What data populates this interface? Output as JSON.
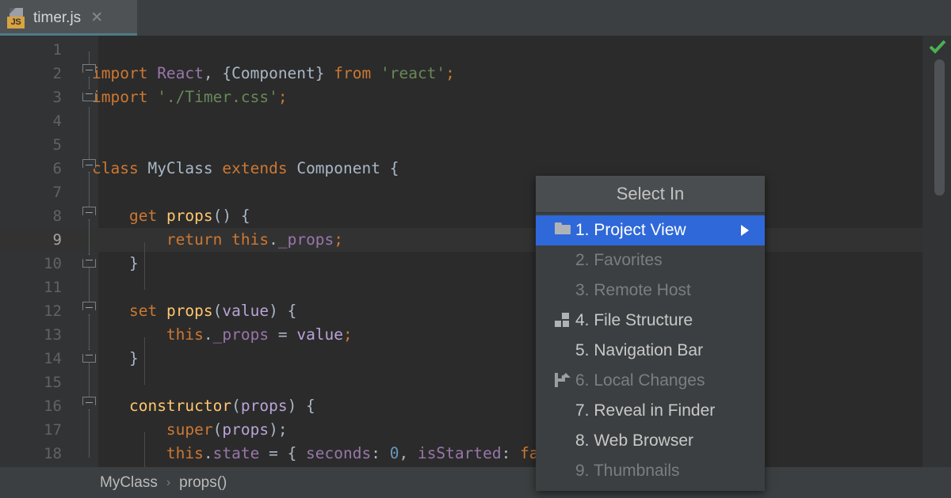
{
  "window": {
    "background": "#3c3f41",
    "editor_background": "#2b2b2b"
  },
  "tab": {
    "title": "timer.js",
    "file_type_badge": "JS",
    "close_label": "✕",
    "icon": "js-file-icon",
    "accent_color": "#4d7b87"
  },
  "editor": {
    "current_line": 9,
    "inspection_status": "ok",
    "lines": [
      {
        "n": 1,
        "tokens": []
      },
      {
        "n": 2,
        "tokens": [
          {
            "t": "import ",
            "c": "kw"
          },
          {
            "t": "React",
            "c": "fld"
          },
          {
            "t": ", ",
            "c": "pun"
          },
          {
            "t": "{Component}",
            "c": "cls"
          },
          {
            "t": " ",
            "c": "pun"
          },
          {
            "t": "from",
            "c": "kw"
          },
          {
            "t": " ",
            "c": "pun"
          },
          {
            "t": "'react'",
            "c": "str"
          },
          {
            "t": ";",
            "c": "kw"
          }
        ]
      },
      {
        "n": 3,
        "tokens": [
          {
            "t": "import ",
            "c": "kw"
          },
          {
            "t": "'./Timer.css'",
            "c": "str"
          },
          {
            "t": ";",
            "c": "kw"
          }
        ]
      },
      {
        "n": 4,
        "tokens": []
      },
      {
        "n": 5,
        "tokens": []
      },
      {
        "n": 6,
        "tokens": [
          {
            "t": "class",
            "c": "kw"
          },
          {
            "t": " ",
            "c": "pun"
          },
          {
            "t": "MyClass",
            "c": "cls"
          },
          {
            "t": " ",
            "c": "pun"
          },
          {
            "t": "extends",
            "c": "kw"
          },
          {
            "t": " ",
            "c": "pun"
          },
          {
            "t": "Component",
            "c": "cls"
          },
          {
            "t": " {",
            "c": "pun"
          }
        ]
      },
      {
        "n": 7,
        "tokens": []
      },
      {
        "n": 8,
        "tokens": [
          {
            "t": "    ",
            "c": "pun"
          },
          {
            "t": "get",
            "c": "kw"
          },
          {
            "t": " ",
            "c": "pun"
          },
          {
            "t": "props",
            "c": "fn"
          },
          {
            "t": "() {",
            "c": "pun"
          }
        ]
      },
      {
        "n": 9,
        "tokens": [
          {
            "t": "        ",
            "c": "pun"
          },
          {
            "t": "return",
            "c": "kw"
          },
          {
            "t": " ",
            "c": "pun"
          },
          {
            "t": "this",
            "c": "kw"
          },
          {
            "t": ".",
            "c": "pun"
          },
          {
            "t": "_props",
            "c": "fld"
          },
          {
            "t": ";",
            "c": "kw"
          }
        ]
      },
      {
        "n": 10,
        "tokens": [
          {
            "t": "    }",
            "c": "pun"
          }
        ]
      },
      {
        "n": 11,
        "tokens": []
      },
      {
        "n": 12,
        "tokens": [
          {
            "t": "    ",
            "c": "pun"
          },
          {
            "t": "set",
            "c": "kw"
          },
          {
            "t": " ",
            "c": "pun"
          },
          {
            "t": "props",
            "c": "fn"
          },
          {
            "t": "(",
            "c": "pun"
          },
          {
            "t": "value",
            "c": "par"
          },
          {
            "t": ") {",
            "c": "pun"
          }
        ]
      },
      {
        "n": 13,
        "tokens": [
          {
            "t": "        ",
            "c": "pun"
          },
          {
            "t": "this",
            "c": "kw"
          },
          {
            "t": ".",
            "c": "pun"
          },
          {
            "t": "_props",
            "c": "fld"
          },
          {
            "t": " = ",
            "c": "pun"
          },
          {
            "t": "value",
            "c": "par"
          },
          {
            "t": ";",
            "c": "kw"
          }
        ]
      },
      {
        "n": 14,
        "tokens": [
          {
            "t": "    }",
            "c": "pun"
          }
        ]
      },
      {
        "n": 15,
        "tokens": []
      },
      {
        "n": 16,
        "tokens": [
          {
            "t": "    ",
            "c": "pun"
          },
          {
            "t": "constructor",
            "c": "fn"
          },
          {
            "t": "(",
            "c": "pun"
          },
          {
            "t": "props",
            "c": "par"
          },
          {
            "t": ") {",
            "c": "pun"
          }
        ]
      },
      {
        "n": 17,
        "tokens": [
          {
            "t": "        ",
            "c": "pun"
          },
          {
            "t": "super",
            "c": "kw"
          },
          {
            "t": "(",
            "c": "pun"
          },
          {
            "t": "props",
            "c": "par"
          },
          {
            "t": ");",
            "c": "pun"
          }
        ]
      },
      {
        "n": 18,
        "tokens": [
          {
            "t": "        ",
            "c": "pun"
          },
          {
            "t": "this",
            "c": "kw"
          },
          {
            "t": ".",
            "c": "pun"
          },
          {
            "t": "state",
            "c": "fld"
          },
          {
            "t": " = { ",
            "c": "pun"
          },
          {
            "t": "seconds",
            "c": "fld"
          },
          {
            "t": ": ",
            "c": "pun"
          },
          {
            "t": "0",
            "c": "num"
          },
          {
            "t": ", ",
            "c": "pun"
          },
          {
            "t": "isStarted",
            "c": "fld"
          },
          {
            "t": ": ",
            "c": "pun"
          },
          {
            "t": "false",
            "c": "kw"
          },
          {
            "t": " };",
            "c": "pun"
          }
        ]
      }
    ]
  },
  "breadcrumb": {
    "items": [
      "MyClass",
      "props()"
    ],
    "separator": "›"
  },
  "menu": {
    "title": "Select In",
    "items": [
      {
        "label": "1. Project View",
        "icon": "folder-icon",
        "selected": true,
        "disabled": false,
        "submenu": true
      },
      {
        "label": "2. Favorites",
        "icon": null,
        "selected": false,
        "disabled": true,
        "submenu": false
      },
      {
        "label": "3. Remote Host",
        "icon": null,
        "selected": false,
        "disabled": true,
        "submenu": false
      },
      {
        "label": "4. File Structure",
        "icon": "structure-icon",
        "selected": false,
        "disabled": false,
        "submenu": false
      },
      {
        "label": "5. Navigation Bar",
        "icon": null,
        "selected": false,
        "disabled": false,
        "submenu": false
      },
      {
        "label": "6. Local Changes",
        "icon": "branch-icon",
        "selected": false,
        "disabled": true,
        "submenu": false
      },
      {
        "label": "7. Reveal in Finder",
        "icon": null,
        "selected": false,
        "disabled": false,
        "submenu": false
      },
      {
        "label": "8. Web Browser",
        "icon": null,
        "selected": false,
        "disabled": false,
        "submenu": false
      },
      {
        "label": "9. Thumbnails",
        "icon": null,
        "selected": false,
        "disabled": true,
        "submenu": false
      }
    ],
    "selection_color": "#2f68d8"
  }
}
